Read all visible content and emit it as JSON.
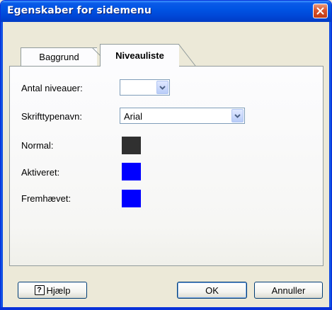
{
  "window": {
    "title": "Egenskaber for sidemenu"
  },
  "tabs": [
    {
      "label": "Baggrund",
      "active": false
    },
    {
      "label": "Niveauliste",
      "active": true
    }
  ],
  "fields": {
    "levels_label": "Antal niveauer:",
    "levels_value": "",
    "font_label": "Skrifttypenavn:",
    "font_value": "Arial",
    "normal_label": "Normal:",
    "activated_label": "Aktiveret:",
    "highlighted_label": "Fremhævet:"
  },
  "colors": {
    "normal": "#303030",
    "activated": "#0000ff",
    "highlighted": "#0000ff",
    "title_bar": "#0054e3",
    "close_button": "#d9532c"
  },
  "buttons": {
    "help": "Hjælp",
    "ok": "OK",
    "cancel": "Annuller"
  },
  "icons": {
    "close": "close-icon",
    "dropdown": "chevron-down-icon",
    "help": "help-book-icon"
  }
}
